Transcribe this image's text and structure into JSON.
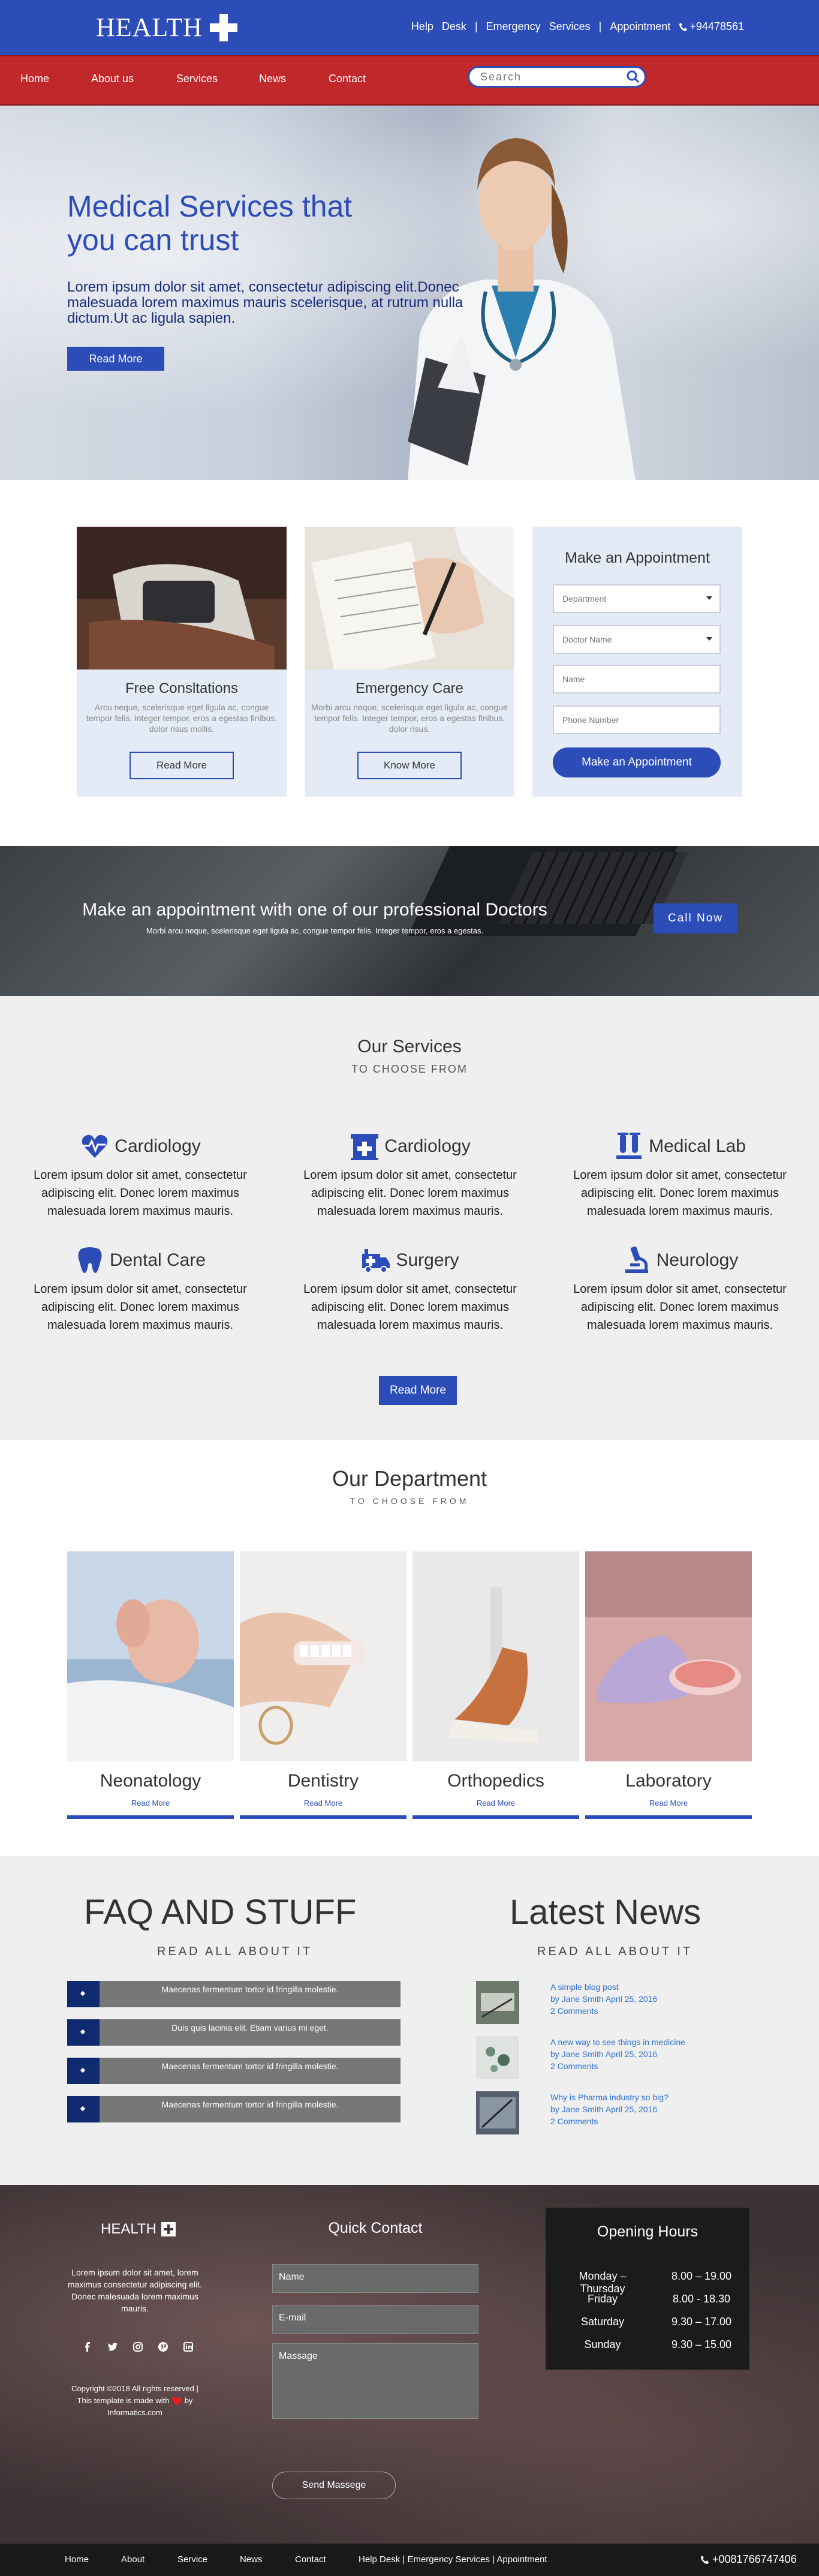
{
  "topbar": {
    "logo": "HEALTH",
    "links": [
      "Help",
      "Desk",
      "|",
      "Emergency",
      "Services",
      "|",
      "Appointment"
    ],
    "phone": "+94478561"
  },
  "nav": {
    "items": [
      "Home",
      "About us",
      "Services",
      "News",
      "Contact"
    ],
    "search_placeholder": "Search"
  },
  "hero": {
    "title": "Medical Services that you can trust",
    "text": "Lorem ipsum dolor sit amet, consectetur adipiscing elit.Donec malesuada lorem maximus mauris scelerisque, at rutrum nulla dictum.Ut ac ligula sapien.",
    "button": "Read More"
  },
  "cards": [
    {
      "title": "Free Consltations",
      "text": "Arcu neque, scelerisque eget ligula ac, congue tempor felis. Integer tempor, eros a egestas finibus, dolor risus mollis.",
      "button": "Read More"
    },
    {
      "title": "Emergency Care",
      "text": "Morbi arcu neque, scelerisque eget ligula ac, congue tempor felis. Integer tempor, eros a egestas finibus, dolor risus.",
      "button": "Know More"
    }
  ],
  "appointment": {
    "title": "Make an Appointment",
    "department": "Department",
    "doctor": "Doctor Name",
    "name": "Name",
    "phone": "Phone Number",
    "button": "Make an Appointment"
  },
  "banner": {
    "title": "Make an appointment with one of our professional Doctors",
    "text": "Morbi arcu neque, scelerisque eget ligula ac, congue tempor felis. Integer tempor, eros a egestas.",
    "button": "Call Now"
  },
  "services": {
    "title": "Our Services",
    "subtitle": "TO CHOOSE FROM",
    "items": [
      {
        "name": "Cardiology",
        "icon": "heartbeat-icon",
        "text": "Lorem ipsum dolor sit amet, consectetur adipiscing elit. Donec lorem maximus malesuada lorem maximus mauris."
      },
      {
        "name": "Cardiology",
        "icon": "hospital-icon",
        "text": "Lorem ipsum dolor sit amet, consectetur adipiscing elit. Donec lorem maximus malesuada lorem maximus mauris."
      },
      {
        "name": "Medical Lab",
        "icon": "flask-icon",
        "text": "Lorem ipsum dolor sit amet, consectetur adipiscing elit. Donec lorem maximus malesuada lorem maximus mauris."
      },
      {
        "name": "Dental Care",
        "icon": "tooth-icon",
        "text": "Lorem ipsum dolor sit amet, consectetur adipiscing elit. Donec lorem maximus malesuada lorem maximus mauris."
      },
      {
        "name": "Surgery",
        "icon": "ambulance-icon",
        "text": "Lorem ipsum dolor sit amet, consectetur adipiscing elit. Donec lorem maximus malesuada lorem maximus mauris."
      },
      {
        "name": "Neurology",
        "icon": "microscope-icon",
        "text": "Lorem ipsum dolor sit amet, consectetur adipiscing elit. Donec lorem maximus malesuada lorem maximus mauris."
      }
    ],
    "button": "Read More"
  },
  "department": {
    "title": "Our Department",
    "subtitle": "TO CHOOSE FROM",
    "items": [
      {
        "name": "Neonatology",
        "link": "Read More"
      },
      {
        "name": "Dentistry",
        "link": "Read More"
      },
      {
        "name": "Orthopedics",
        "link": "Read More"
      },
      {
        "name": "Laboratory",
        "link": "Read More"
      }
    ]
  },
  "faq": {
    "title": "FAQ AND STUFF",
    "subtitle": "READ ALL ABOUT IT",
    "items": [
      "Maecenas fermentum tortor id fringilla molestie.",
      "Duis quis lacinia elit. Etiam varius mi eget.",
      "Maecenas fermentum tortor id fringilla molestie.",
      "Maecenas fermentum tortor id fringilla molestie."
    ]
  },
  "news": {
    "title": "Latest News",
    "subtitle": "READ ALL ABOUT IT",
    "items": [
      {
        "title": "A simple blog post",
        "by": "by Jane Smith April 25, 2016",
        "comments": "2 Comments"
      },
      {
        "title": "A new way to see things in medicine",
        "by": "by Jane Smith April 25, 2016",
        "comments": "2 Comments"
      },
      {
        "title": "Why is Pharma industry so big?",
        "by": "by Jane Smith April 25, 2016",
        "comments": "2 Comments"
      }
    ]
  },
  "footer": {
    "logo": "HEALTH",
    "about": "Lorem ipsum dolor sit amet, lorem maximus consectetur adipiscing elit. Donec malesuada lorem maximus mauris.",
    "copyright": "Copyright ©2018 All rights reserved | This template is made with",
    "copyright_by": "by",
    "copyright_site": "Informatics.com",
    "quick_contact": "Quick Contact",
    "name": "Name",
    "email": "E-mail",
    "message": "Massage",
    "send": "Send Massege",
    "hours_title": "Opening Hours",
    "hours": [
      {
        "day": "Monday – Thursday",
        "time": "8.00 – 19.00"
      },
      {
        "day": "Friday",
        "time": "8.00 - 18.30"
      },
      {
        "day": "Saturday",
        "time": "9.30 – 17.00"
      },
      {
        "day": "Sunday",
        "time": "9.30 – 15.00"
      }
    ]
  },
  "bottom": {
    "links": [
      "Home",
      "About",
      "Service",
      "News",
      "Contact"
    ],
    "center": "Help Desk | Emergency Services | Appointment",
    "phone": "+0081766747406"
  }
}
